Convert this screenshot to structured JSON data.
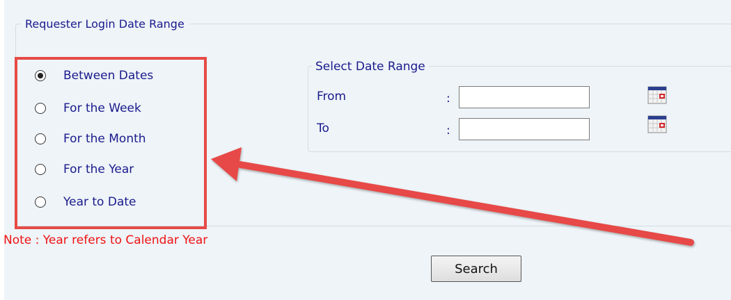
{
  "outer_legend": "Requester Login Date Range",
  "period_options": [
    {
      "label": "Between Dates",
      "selected": true
    },
    {
      "label": "For the Week",
      "selected": false
    },
    {
      "label": "For the Month",
      "selected": false
    },
    {
      "label": "For the Year",
      "selected": false
    },
    {
      "label": "Year to Date",
      "selected": false
    }
  ],
  "date_range": {
    "legend": "Select Date Range",
    "separator": ":",
    "from": {
      "label": "From",
      "value": "",
      "icon": "calendar-icon"
    },
    "to": {
      "label": "To",
      "value": "",
      "icon": "calendar-icon"
    }
  },
  "note": "Note : Year refers to Calendar Year",
  "search_label": "Search",
  "colors": {
    "background": "#eef4f8",
    "label_text": "#1a1a8c",
    "note_text": "#ee1111",
    "annotation_red": "#e64a46"
  }
}
